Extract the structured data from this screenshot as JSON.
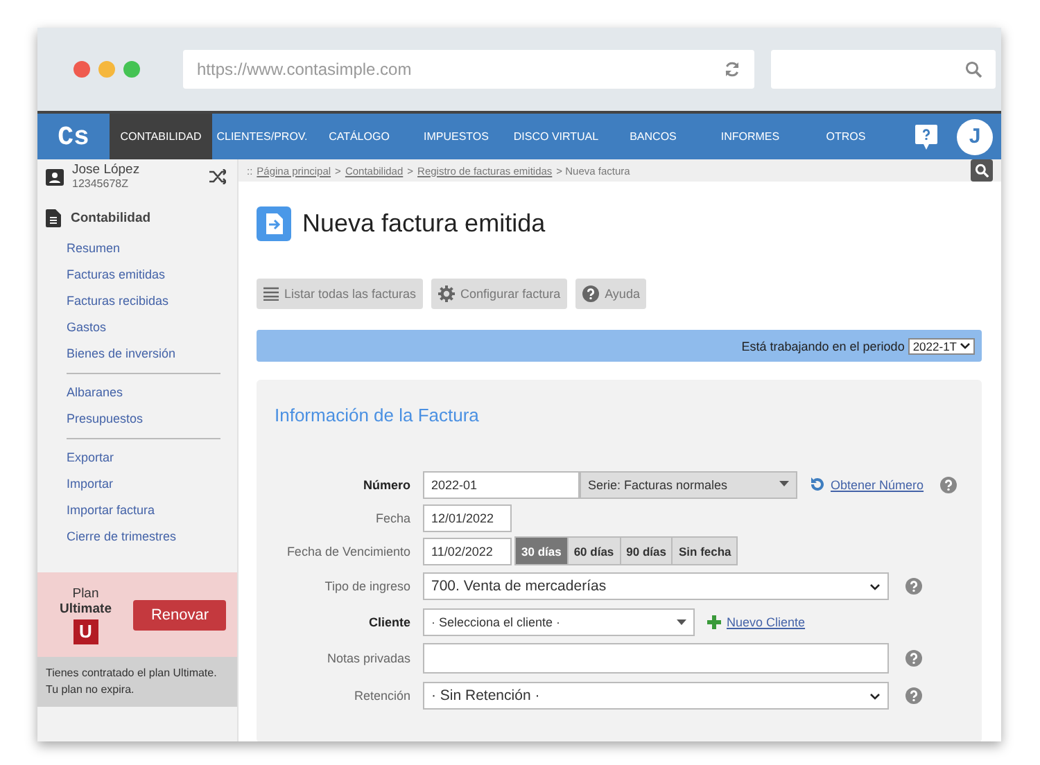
{
  "browser": {
    "url": "https://www.contasimple.com"
  },
  "nav": {
    "logo": "Cs",
    "items": [
      {
        "label": "CONTABILIDAD",
        "selected": true
      },
      {
        "label": "CLIENTES/PROV.",
        "selected": false
      },
      {
        "label": "CATÁLOGO",
        "selected": false
      },
      {
        "label": "IMPUESTOS",
        "selected": false
      },
      {
        "label": "DISCO VIRTUAL",
        "selected": false
      },
      {
        "label": "BANCOS",
        "selected": false
      },
      {
        "label": "INFORMES",
        "selected": false
      },
      {
        "label": "OTROS",
        "selected": false
      }
    ],
    "avatar": "J"
  },
  "user": {
    "name": "Jose López",
    "id": "12345678Z"
  },
  "sidebar": {
    "title": "Contabilidad",
    "groups": [
      [
        "Resumen",
        "Facturas emitidas",
        "Facturas recibidas",
        "Gastos",
        "Bienes de inversión"
      ],
      [
        "Albaranes",
        "Presupuestos"
      ],
      [
        "Exportar",
        "Importar",
        "Importar factura",
        "Cierre de trimestres"
      ]
    ]
  },
  "plan": {
    "label": "Plan",
    "name": "Ultimate",
    "badge": "U",
    "button": "Renovar",
    "info": "Tienes contratado el plan Ultimate. Tu plan no expira."
  },
  "breadcrumb": [
    {
      "label": "::"
    },
    {
      "label": "Página principal",
      "link": true
    },
    {
      "label": ">"
    },
    {
      "label": "Contabilidad",
      "link": true
    },
    {
      "label": ">"
    },
    {
      "label": "Registro de facturas emitidas",
      "link": true
    },
    {
      "label": "> Nueva factura"
    }
  ],
  "page_title": "Nueva factura emitida",
  "toolbar": [
    {
      "label": "Listar todas las facturas",
      "kind": "list"
    },
    {
      "label": "Configurar factura",
      "kind": "settings"
    },
    {
      "label": "Ayuda",
      "kind": "help"
    }
  ],
  "period": {
    "label": "Está trabajando en el periodo",
    "value": "2022-1T"
  },
  "form": {
    "title": "Información de la Factura",
    "rows": [
      {
        "kind": "number",
        "label": "Número",
        "required": true,
        "value": "2022-01",
        "select": "Serie: Facturas normales",
        "link": "Obtener Número",
        "help": true
      },
      {
        "kind": "date",
        "label": "Fecha",
        "required": false,
        "value": "12/01/2022"
      },
      {
        "kind": "due",
        "label": "Fecha de Vencimiento",
        "required": false,
        "value": "11/02/2022",
        "options": [
          {
            "label": "30 días",
            "selected": true
          },
          {
            "label": "60 días",
            "selected": false
          },
          {
            "label": "90 días",
            "selected": false
          },
          {
            "label": "Sin fecha",
            "selected": false
          }
        ]
      },
      {
        "kind": "select",
        "label": "Tipo de ingreso",
        "required": false,
        "value": "700. Venta de mercaderías",
        "help": true
      },
      {
        "kind": "client",
        "label": "Cliente",
        "required": true,
        "placeholder": "· Selecciona el cliente ·",
        "link": "Nuevo Cliente"
      },
      {
        "kind": "textarea",
        "label": "Notas privadas",
        "required": false,
        "help": true
      },
      {
        "kind": "select",
        "label": "Retención",
        "required": false,
        "value": "· Sin Retención ·",
        "help": true
      }
    ]
  }
}
